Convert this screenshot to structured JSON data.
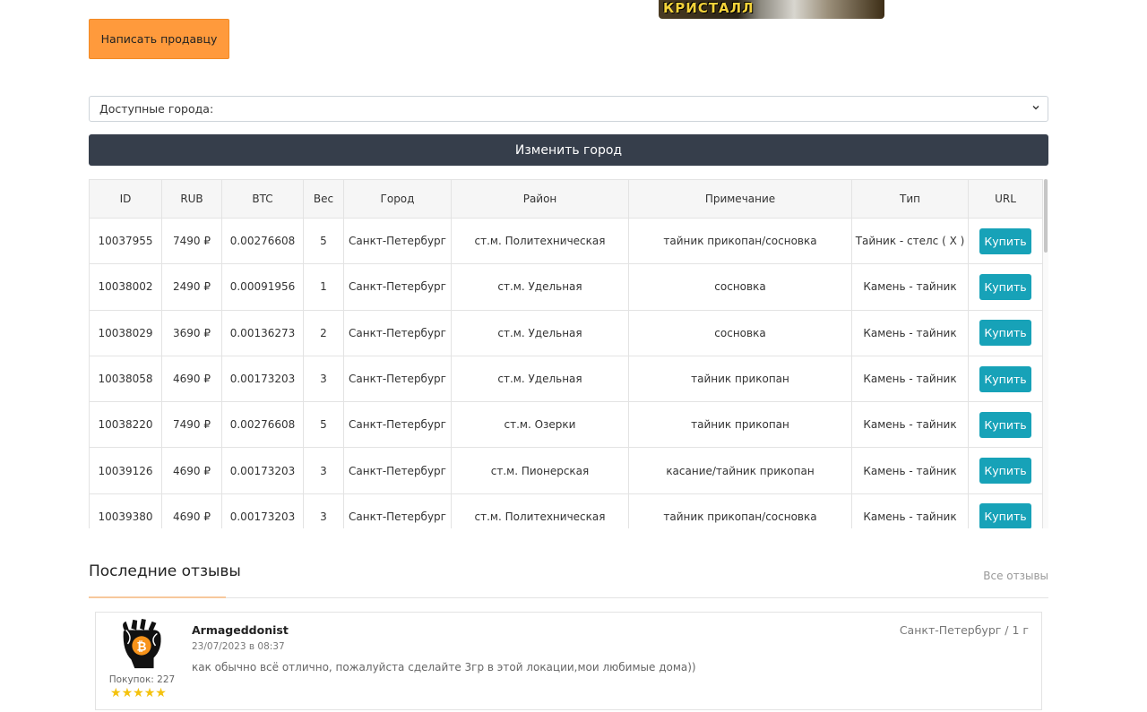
{
  "banner": {
    "text": "КРИСТАЛЛ"
  },
  "write_seller_label": "Написать продавцу",
  "city_select": {
    "selected": "Доступные города:"
  },
  "change_city_label": "Изменить город",
  "table": {
    "headers": [
      "ID",
      "RUB",
      "BTC",
      "Вес",
      "Город",
      "Район",
      "Примечание",
      "Тип",
      "URL"
    ],
    "buy_label": "Купить",
    "rows": [
      {
        "id": "10037955",
        "rub": "7490 ₽",
        "btc": "0.00276608",
        "weight": "5",
        "city": "Санкт-Петербург",
        "district": "ст.м. Политехническая",
        "note": "тайник прикопан/сосновка",
        "type": "Тайник - стелс ( Х )"
      },
      {
        "id": "10038002",
        "rub": "2490 ₽",
        "btc": "0.00091956",
        "weight": "1",
        "city": "Санкт-Петербург",
        "district": "ст.м. Удельная",
        "note": "сосновка",
        "type": "Камень - тайник"
      },
      {
        "id": "10038029",
        "rub": "3690 ₽",
        "btc": "0.00136273",
        "weight": "2",
        "city": "Санкт-Петербург",
        "district": "ст.м. Удельная",
        "note": "сосновка",
        "type": "Камень - тайник"
      },
      {
        "id": "10038058",
        "rub": "4690 ₽",
        "btc": "0.00173203",
        "weight": "3",
        "city": "Санкт-Петербург",
        "district": "ст.м. Удельная",
        "note": "тайник прикопан",
        "type": "Камень - тайник"
      },
      {
        "id": "10038220",
        "rub": "7490 ₽",
        "btc": "0.00276608",
        "weight": "5",
        "city": "Санкт-Петербург",
        "district": "ст.м. Озерки",
        "note": "тайник прикопан",
        "type": "Камень - тайник"
      },
      {
        "id": "10039126",
        "rub": "4690 ₽",
        "btc": "0.00173203",
        "weight": "3",
        "city": "Санкт-Петербург",
        "district": "ст.м. Пионерская",
        "note": "касание/тайник прикопан",
        "type": "Камень - тайник"
      },
      {
        "id": "10039380",
        "rub": "4690 ₽",
        "btc": "0.00173203",
        "weight": "3",
        "city": "Санкт-Петербург",
        "district": "ст.м. Политехническая",
        "note": "тайник прикопан/сосновка",
        "type": "Камень - тайник"
      }
    ]
  },
  "reviews": {
    "title": "Последние отзывы",
    "all_link": "Все отзывы",
    "items": [
      {
        "name": "Armageddonist",
        "date": "23/07/2023 в 08:37",
        "text": "как обычно всё отлично, пожалуйста сделайте 3гр в этой локации,мои любимые дома))",
        "location": "Санкт-Петербург / 1 г",
        "purchases": "Покупок: 227",
        "rating": 5
      }
    ]
  },
  "colors": {
    "accent": "#ff9a3c",
    "dark": "#363e4b",
    "buy": "#17a2b8",
    "star": "#f4c20d"
  }
}
